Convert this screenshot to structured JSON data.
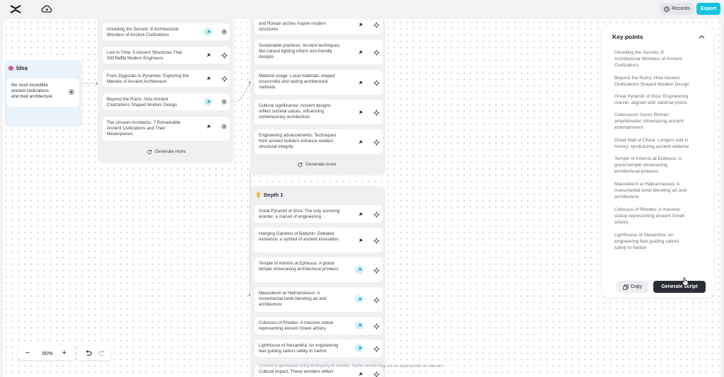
{
  "topbar": {
    "recents_label": "Recents",
    "export_label": "Export",
    "icons": [
      "capcut-logo-icon",
      "cloud-icon",
      "clock-icon"
    ]
  },
  "idea": {
    "title": "Idea",
    "text_lines": [
      "the most incredible",
      "ancient civilizations",
      "and their architecture"
    ]
  },
  "col1": {
    "items": [
      {
        "lines": [
          "Unveiling the Secrets: 8 Architectural",
          "Wonders of Ancient Civilizations"
        ],
        "pinned": true
      },
      {
        "lines": [
          "Lost in Time: 5 Ancient Structures That",
          "Still Baffle Modern Engineers"
        ],
        "pinned": false
      },
      {
        "lines": [
          "From Ziggurats to Pyramids: Exploring the",
          "Marvels of Ancient Architecture"
        ],
        "pinned": false
      },
      {
        "lines": [
          "Beyond the Ruins: How Ancient",
          "Civilizations Shaped Modern Design"
        ],
        "pinned": true
      },
      {
        "lines": [
          "The Unseen Architects: 7 Remarkable",
          "Ancient Civilizations and Their",
          "Masterpieces"
        ],
        "pinned": false
      }
    ],
    "generate_more": "Generate more"
  },
  "col2": {
    "items": [
      {
        "lines": [
          "and Roman arches inspire modern",
          "structures"
        ]
      },
      {
        "lines": [
          "Sustainable practices: Ancient techniques",
          "like natural lighting inform eco-friendly",
          "designs"
        ]
      },
      {
        "lines": [
          "Material usage: Local materials shaped",
          "resourceful and lasting architectural",
          "methods"
        ]
      },
      {
        "lines": [
          "Cultural significance: Ancient designs",
          "reflect societal values, influencing",
          "contemporary architecture"
        ]
      },
      {
        "lines": [
          "Engineering advancements: Techniques",
          "from ancient builders enhance modern",
          "structural integrity"
        ]
      }
    ],
    "generate_more": "Generate more"
  },
  "depth": {
    "title": "Depth 1",
    "items": [
      {
        "lines": [
          "Great Pyramid of Giza: The only surviving",
          "wonder, a marvel of engineering"
        ],
        "pinned": false
      },
      {
        "lines": [
          "Hanging Gardens of Babylon: Debated",
          "existence, a symbol of ancient innovation"
        ],
        "pinned": false
      },
      {
        "lines": [
          "Temple of Artemis at Ephesus: A grand",
          "temple showcasing architectural prowess"
        ],
        "pinned": true
      },
      {
        "lines": [
          "Mausoleum at Halicarnassus: A",
          "monumental tomb blending art and",
          "architecture"
        ],
        "pinned": true
      },
      {
        "lines": [
          "Colossus of Rhodes: A massive statue",
          "representing ancient Greek artistry"
        ],
        "pinned": true
      },
      {
        "lines": [
          "Lighthouse of Alexandria: An engineering",
          "feat guiding sailors safely to harbor"
        ],
        "pinned": true
      },
      {
        "lines": [
          "Cultural impact: These wonders reflect"
        ],
        "pinned": false
      }
    ]
  },
  "key_points": {
    "title": "Key points",
    "items": [
      {
        "lines": [
          "Unveiling the Secrets: 8",
          "Architectural Wonders of Ancient",
          "Civilizations"
        ]
      },
      {
        "lines": [
          "Beyond the Ruins: How Ancient",
          "Civilizations Shaped Modern Design"
        ]
      },
      {
        "lines": [
          "Great Pyramid of Giza: Engineering",
          "marvel, aligned with cardinal points"
        ]
      },
      {
        "lines": [
          "Colosseum: Iconic Roman",
          "amphitheater showcasing ancient",
          "entertainment"
        ]
      },
      {
        "lines": [
          "Great Wall of China: Longest wall in",
          "history, symbolizing ancient defense"
        ]
      },
      {
        "lines": [
          "Temple of Artemis at Ephesus: A",
          "grand temple showcasing",
          "architectural prowess"
        ]
      },
      {
        "lines": [
          "Mausoleum at Halicarnassus: A",
          "monumental tomb blending art and",
          "architecture"
        ]
      },
      {
        "lines": [
          "Colossus of Rhodes: A massive",
          "statue representing ancient Greek",
          "artistry"
        ]
      },
      {
        "lines": [
          "Lighthouse of Alexandria: An",
          "engineering feat guiding sailors",
          "safely to harbor"
        ]
      }
    ],
    "copy_label": "Copy",
    "generate_script_label": "Generate script"
  },
  "zoom": {
    "level": "90%",
    "minus": "−",
    "plus": "+"
  },
  "disclaimer": "Content is generated using third-party AI models. Some results may not be appropriate or relevant.",
  "colors": {
    "accent": "#17c1e0",
    "dark_button": "#2a2d33",
    "pin_active_bg": "#d3f0f8"
  }
}
